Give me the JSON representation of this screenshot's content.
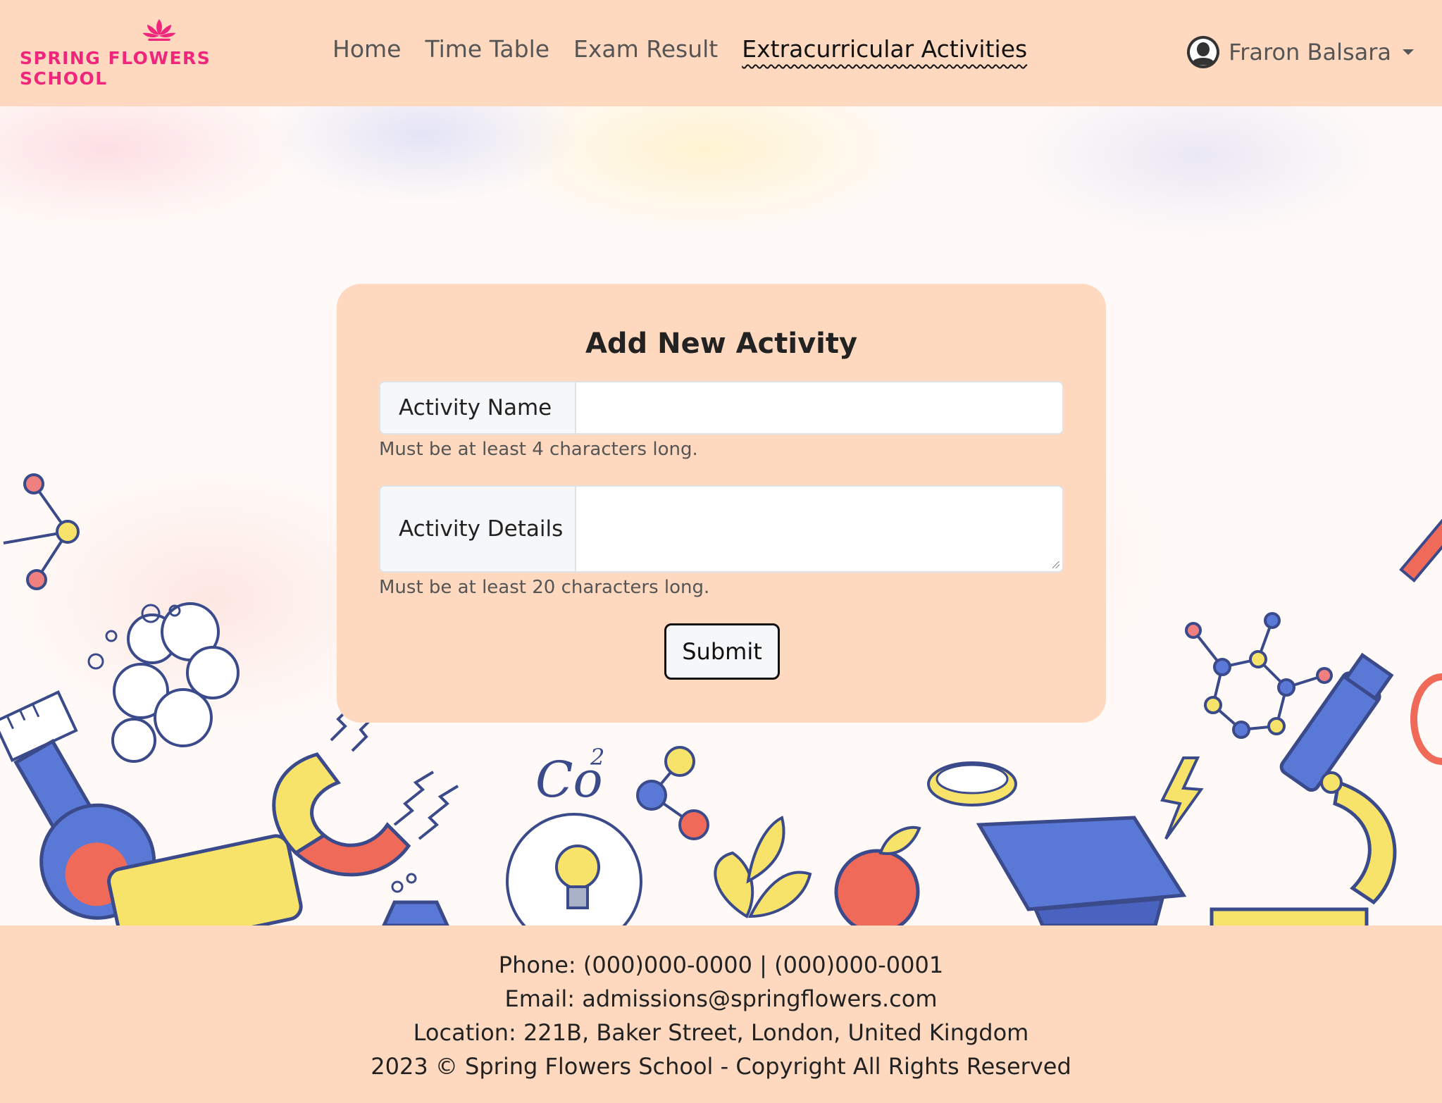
{
  "brand": {
    "name": "SPRING FLOWERS SCHOOL",
    "icon": "lotus-icon",
    "color": "#f0267d"
  },
  "nav": {
    "links": [
      {
        "label": "Home",
        "active": false
      },
      {
        "label": "Time Table",
        "active": false
      },
      {
        "label": "Exam Result",
        "active": false
      },
      {
        "label": "Extracurricular Activities",
        "active": true
      }
    ]
  },
  "user": {
    "name": "Fraron Balsara",
    "icon": "user-circle-icon"
  },
  "form": {
    "title": "Add New Activity",
    "activity_name": {
      "label": "Activity Name",
      "value": "",
      "hint": "Must be at least 4 characters long."
    },
    "activity_details": {
      "label": "Activity Details",
      "value": "",
      "hint": "Must be at least 20 characters long."
    },
    "submit_label": "Submit"
  },
  "footer": {
    "phone": "Phone: (000)000-0000 | (000)000-0001",
    "email": "Email: admissions@springflowers.com",
    "location": "Location: 221B, Baker Street, London, United Kingdom",
    "copyright": "2023 © Spring Flowers School - Copyright All Rights Reserved"
  },
  "colors": {
    "header_bg": "#ffd9bf",
    "card_bg": "#ffd9bf",
    "accent_pink": "#f0267d"
  }
}
